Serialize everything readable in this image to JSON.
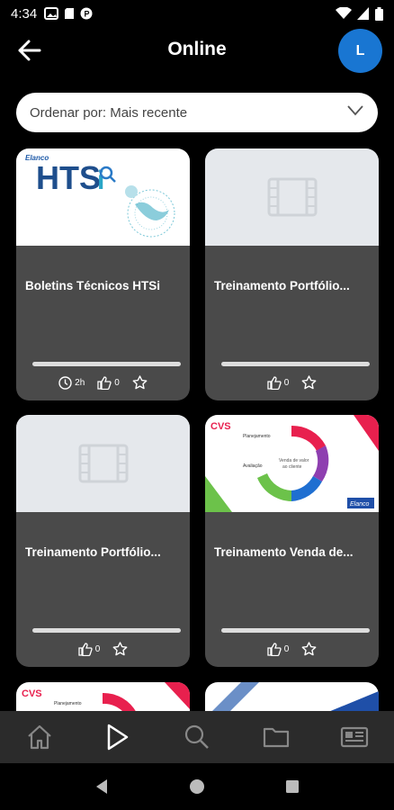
{
  "status": {
    "time": "4:34"
  },
  "header": {
    "title": "Online",
    "avatar_letter": "L"
  },
  "sort": {
    "label": "Ordenar por: Mais recente"
  },
  "cards": [
    {
      "title": "Boletins Técnicos HTSi",
      "duration": "2h",
      "likes": "0",
      "thumb_brand": "HTSi",
      "thumb_small": "Elanco"
    },
    {
      "title": "Treinamento Portfólio...",
      "likes": "0"
    },
    {
      "title": "Treinamento Portfólio...",
      "likes": "0"
    },
    {
      "title": "Treinamento Venda de...",
      "likes": "0",
      "thumb_brand": "CVS"
    }
  ],
  "partials": [
    {
      "brand": "CVS"
    },
    {
      "brand": ""
    }
  ],
  "colors": {
    "accent": "#1976d2",
    "card": "#4a4a4a",
    "nav": "#2b2b2b"
  }
}
